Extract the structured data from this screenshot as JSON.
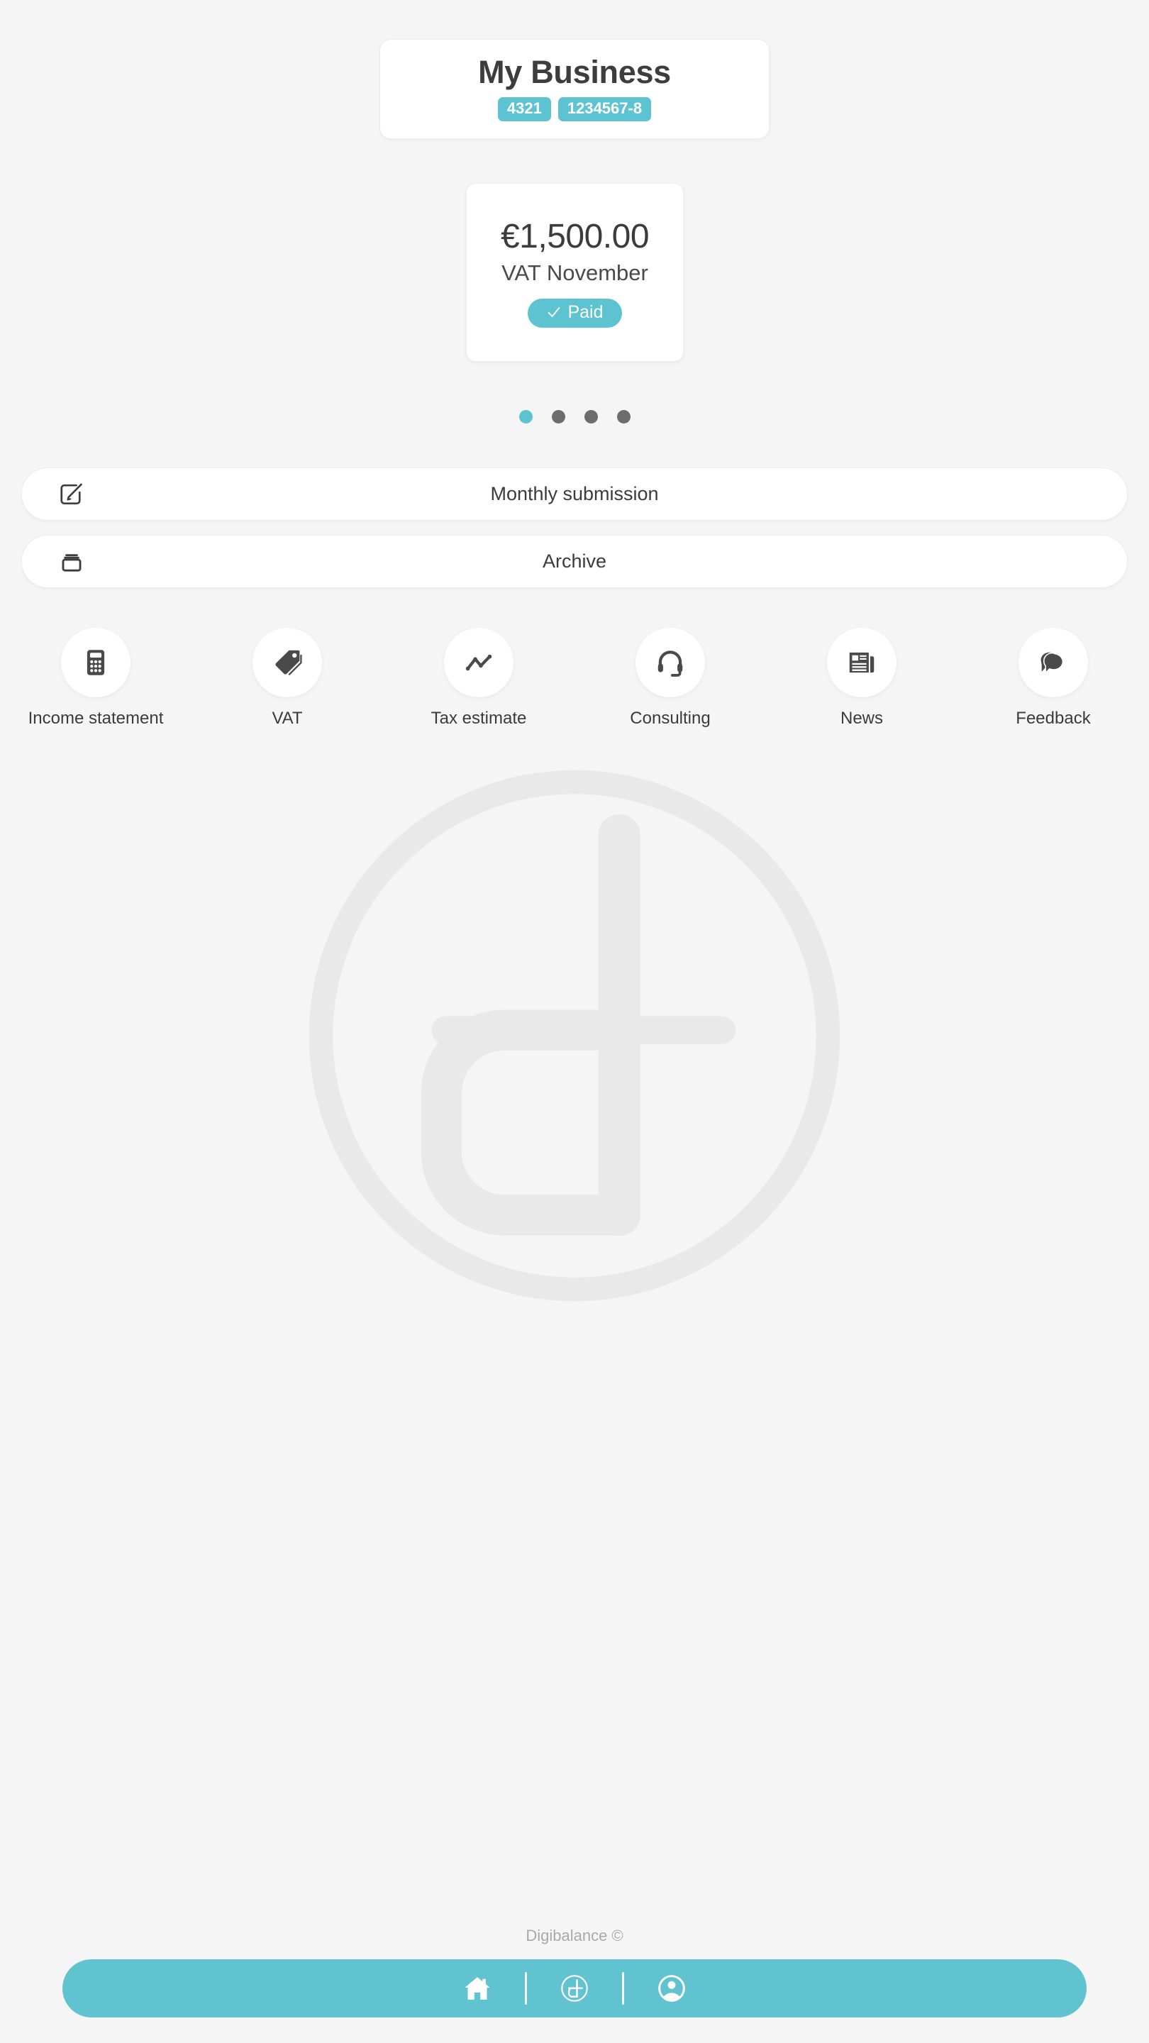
{
  "app": {
    "brand": "Digibalance",
    "accent_color": "#5ec3d0",
    "background_color": "#f5f5f5",
    "text_color": "#3b3b3b"
  },
  "header": {
    "business_name": "My Business",
    "badges": [
      {
        "name": "client-number",
        "value": "4321"
      },
      {
        "name": "tax-id",
        "value": "1234567-8"
      }
    ]
  },
  "summary_card": {
    "amount": "€1,500.00",
    "period": "VAT November",
    "status": "Paid",
    "status_icon": "check-icon",
    "status_color": "#5ec3d0"
  },
  "carousel": {
    "total": 4,
    "active_index": 0,
    "dots": [
      {
        "active": true
      },
      {
        "active": false
      },
      {
        "active": false
      },
      {
        "active": false
      }
    ]
  },
  "action_rows": [
    {
      "label": "Monthly submission",
      "icon": "edit-square-icon"
    },
    {
      "label": "Archive",
      "icon": "archive-box-icon"
    }
  ],
  "quick_actions": [
    {
      "label": "Income statement",
      "icon": "calculator-icon"
    },
    {
      "label": "VAT",
      "icon": "price-tag-icon"
    },
    {
      "label": "Tax estimate",
      "icon": "line-chart-icon"
    },
    {
      "label": "Consulting",
      "icon": "headset-icon"
    },
    {
      "label": "News",
      "icon": "newspaper-icon"
    },
    {
      "label": "Feedback",
      "icon": "speech-bubbles-icon"
    }
  ],
  "watermark": {
    "icon": "digibalance-logo-watermark",
    "color": "#e9e9e9"
  },
  "footer": {
    "credit": "Digibalance ©"
  },
  "bottom_nav": {
    "background_color": "#61c3d0",
    "items": [
      {
        "label": "Home",
        "icon": "home-icon",
        "active": true
      },
      {
        "label": "Digibalance",
        "icon": "digibalance-logo-icon",
        "active": false
      },
      {
        "label": "Profile",
        "icon": "user-circle-icon",
        "active": false
      }
    ]
  }
}
